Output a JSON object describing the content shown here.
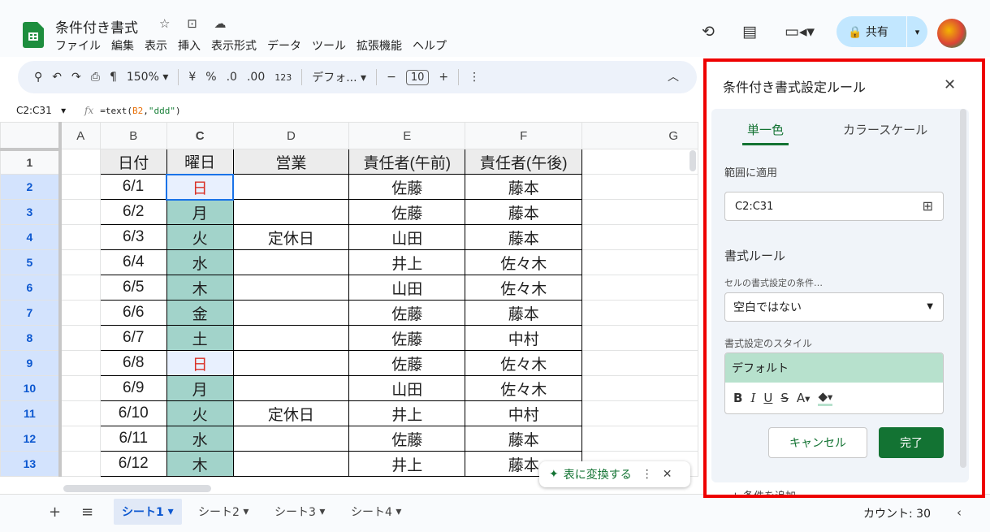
{
  "app": {
    "doc_title": "条件付き書式",
    "title_icons": "☆ ⊡ ☁"
  },
  "menu": [
    "ファイル",
    "編集",
    "表示",
    "挿入",
    "表示形式",
    "データ",
    "ツール",
    "拡張機能",
    "ヘルプ"
  ],
  "header": {
    "share_label": "共有",
    "share_dropdown": "▾"
  },
  "toolbar": {
    "zoom": "150%",
    "currency": "¥",
    "percent": "%",
    "dec_decrease": ".0",
    "dec_increase": ".00",
    "number_format": "123",
    "font": "デフォ...",
    "font_size": "10",
    "minus": "−",
    "plus": "+",
    "more": "⋮"
  },
  "formula_bar": {
    "name_box": "C2:C31",
    "fx": "fx",
    "func": "=text(",
    "ref": "B2",
    "comma": ",",
    "arg": "\"ddd\"",
    "close": ")"
  },
  "columns": [
    "A",
    "B",
    "C",
    "D",
    "E",
    "F",
    "G"
  ],
  "rows": [
    {
      "num": "1",
      "b": "日付",
      "c": "曜日",
      "d": "営業",
      "e": "責任者(午前)",
      "f": "責任者(午後)"
    },
    {
      "num": "2",
      "b": "6/1",
      "c": "日",
      "d": "",
      "e": "佐藤",
      "f": "藤本"
    },
    {
      "num": "3",
      "b": "6/2",
      "c": "月",
      "d": "",
      "e": "佐藤",
      "f": "藤本"
    },
    {
      "num": "4",
      "b": "6/3",
      "c": "火",
      "d": "定休日",
      "e": "山田",
      "f": "藤本"
    },
    {
      "num": "5",
      "b": "6/4",
      "c": "水",
      "d": "",
      "e": "井上",
      "f": "佐々木"
    },
    {
      "num": "6",
      "b": "6/5",
      "c": "木",
      "d": "",
      "e": "山田",
      "f": "佐々木"
    },
    {
      "num": "7",
      "b": "6/6",
      "c": "金",
      "d": "",
      "e": "佐藤",
      "f": "藤本"
    },
    {
      "num": "8",
      "b": "6/7",
      "c": "土",
      "d": "",
      "e": "佐藤",
      "f": "中村"
    },
    {
      "num": "9",
      "b": "6/8",
      "c": "日",
      "d": "",
      "e": "佐藤",
      "f": "佐々木"
    },
    {
      "num": "10",
      "b": "6/9",
      "c": "月",
      "d": "",
      "e": "山田",
      "f": "佐々木"
    },
    {
      "num": "11",
      "b": "6/10",
      "c": "火",
      "d": "定休日",
      "e": "井上",
      "f": "中村"
    },
    {
      "num": "12",
      "b": "6/11",
      "c": "水",
      "d": "",
      "e": "佐藤",
      "f": "藤本"
    },
    {
      "num": "13",
      "b": "6/12",
      "c": "木",
      "d": "",
      "e": "井上",
      "f": "藤本"
    }
  ],
  "table_chip": {
    "label": "表に変換する",
    "more": "⋮",
    "close": "✕"
  },
  "sheets": {
    "add": "+",
    "all": "≡",
    "tabs": [
      "シート1",
      "シート2",
      "シート3",
      "シート4"
    ],
    "active": "シート1",
    "tab_arrow": "▾"
  },
  "status": {
    "count": "カウント: 30",
    "collapse": "‹"
  },
  "panel": {
    "title": "条件付き書式設定ルール",
    "close": "✕",
    "tab_single": "単一色",
    "tab_scale": "カラースケール",
    "range_label": "範囲に適用",
    "range_value": "C2:C31",
    "rules_label": "書式ルール",
    "condition_label": "セルの書式設定の条件…",
    "condition_value": "空白ではない",
    "style_label": "書式設定のスタイル",
    "style_preview": "デフォルト",
    "style_buttons": {
      "bold": "B",
      "italic": "I",
      "underline": "U",
      "strike": "S",
      "text_color": "A",
      "fill": "◆"
    },
    "cancel": "キャンセル",
    "done": "完了",
    "add_condition": "+ 条件を追加"
  },
  "colors": {
    "accent_green": "#137333",
    "selection_blue": "#1a73e8",
    "teal_fill": "#a2d3ca",
    "sunday_red": "#d93025",
    "panel_highlight": "#ff0000"
  }
}
